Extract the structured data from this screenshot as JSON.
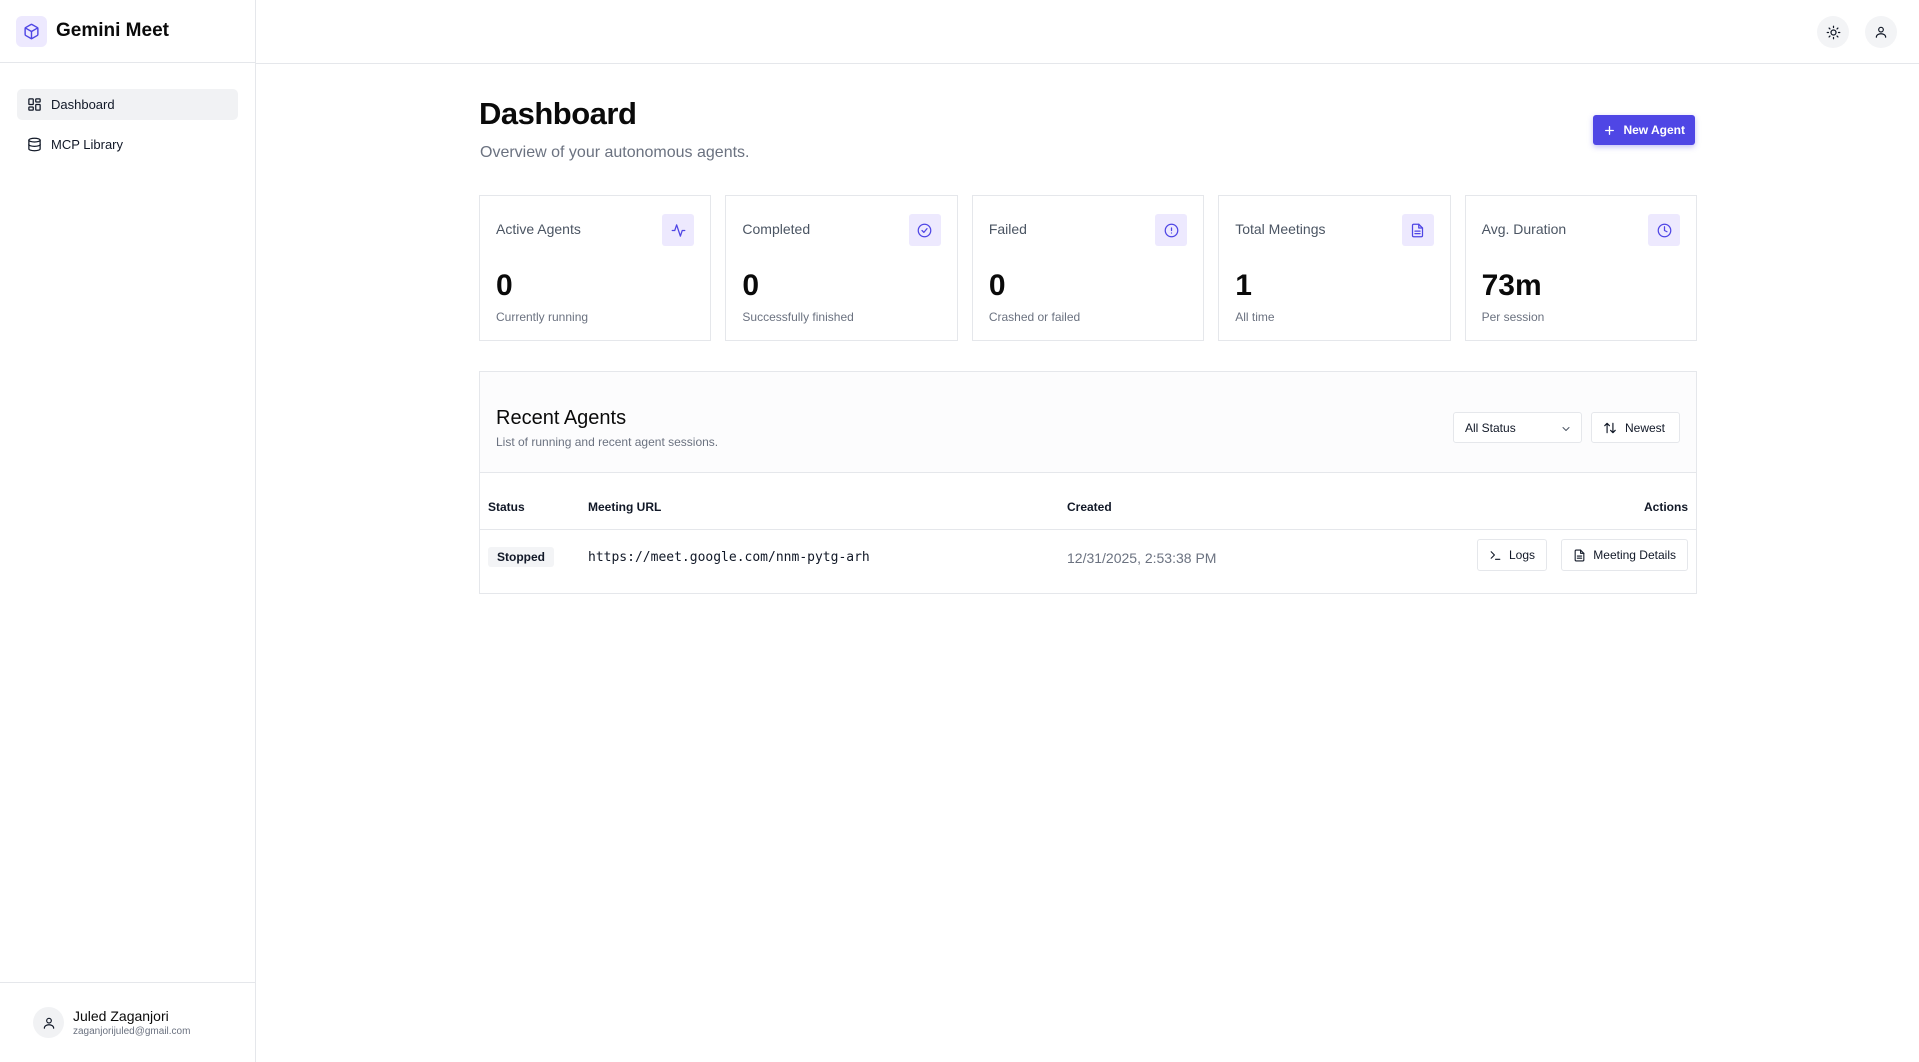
{
  "app": {
    "name": "Gemini Meet"
  },
  "sidebar": {
    "items": [
      {
        "label": "Dashboard",
        "icon": "grid-icon",
        "active": true
      },
      {
        "label": "MCP Library",
        "icon": "database-icon",
        "active": false
      }
    ],
    "user": {
      "name": "Juled Zaganjori",
      "email": "zaganjorijuled@gmail.com"
    }
  },
  "header": {
    "theme_icon": "sun-icon",
    "user_icon": "user-icon"
  },
  "page": {
    "title": "Dashboard",
    "subtitle": "Overview of your autonomous agents.",
    "new_agent_label": "New Agent"
  },
  "stats": [
    {
      "label": "Active Agents",
      "value": "0",
      "desc": "Currently running",
      "icon": "activity-icon"
    },
    {
      "label": "Completed",
      "value": "0",
      "desc": "Successfully finished",
      "icon": "check-circle-icon"
    },
    {
      "label": "Failed",
      "value": "0",
      "desc": "Crashed or failed",
      "icon": "alert-circle-icon"
    },
    {
      "label": "Total Meetings",
      "value": "1",
      "desc": "All time",
      "icon": "file-text-icon"
    },
    {
      "label": "Avg. Duration",
      "value": "73m",
      "desc": "Per session",
      "icon": "clock-icon"
    }
  ],
  "recent": {
    "title": "Recent Agents",
    "subtitle": "List of running and recent agent sessions.",
    "status_filter": "All Status",
    "sort_label": "Newest",
    "columns": {
      "status": "Status",
      "url": "Meeting URL",
      "created": "Created",
      "actions": "Actions"
    },
    "rows": [
      {
        "status": "Stopped",
        "url": "https://meet.google.com/nnm-pytg-arh",
        "created": "12/31/2025, 2:53:38 PM",
        "logs_label": "Logs",
        "details_label": "Meeting Details"
      }
    ]
  },
  "colors": {
    "accent": "#4f46e5",
    "accent_soft": "#ede9fe",
    "border": "#e5e7eb"
  }
}
